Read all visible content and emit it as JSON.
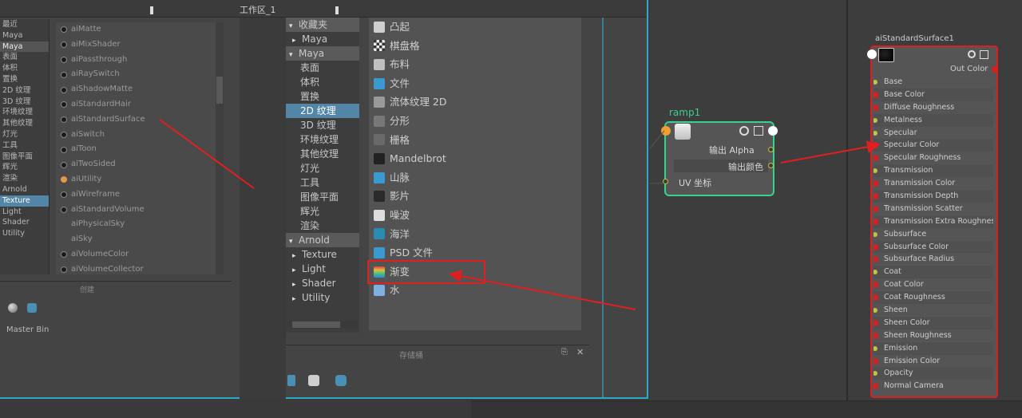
{
  "window": {
    "tab_title": "工作区_1"
  },
  "left_categories": {
    "items": [
      "最近",
      "Maya",
      "Maya",
      "表面",
      "体积",
      "置换",
      "2D 纹理",
      "3D 纹理",
      "环境纹理",
      "其他纹理",
      "灯光",
      "工具",
      "图像平面",
      "辉光",
      "渲染",
      "Arnold",
      "Texture",
      "Light",
      "Shader",
      "Utility"
    ],
    "selected": 16
  },
  "left_nodes": {
    "items": [
      {
        "label": "aiMatte",
        "dot": "dark"
      },
      {
        "label": "aiMixShader",
        "dot": "dark"
      },
      {
        "label": "aiPassthrough",
        "dot": "dark"
      },
      {
        "label": "aiRaySwitch",
        "dot": "dark"
      },
      {
        "label": "aiShadowMatte",
        "dot": "dark"
      },
      {
        "label": "aiStandardHair",
        "dot": "dark"
      },
      {
        "label": "aiStandardSurface",
        "dot": "dark"
      },
      {
        "label": "aiSwitch",
        "dot": "dark"
      },
      {
        "label": "aiToon",
        "dot": "dark"
      },
      {
        "label": "aiTwoSided",
        "dot": "dark"
      },
      {
        "label": "aiUtility",
        "dot": "orange"
      },
      {
        "label": "aiWireframe",
        "dot": "dark"
      },
      {
        "label": "aiStandardVolume",
        "dot": "dark"
      },
      {
        "label": "aiPhysicalSky",
        "dot": "blank"
      },
      {
        "label": "aiSky",
        "dot": "blank"
      },
      {
        "label": "aiVolumeColor",
        "dot": "dark"
      },
      {
        "label": "aiVolumeCollector",
        "dot": "dark"
      }
    ],
    "bottom_title": "创建",
    "master_bin": "Master Bin"
  },
  "mid_categories": {
    "items": [
      {
        "label": "收藏夹",
        "kind": "hdr",
        "tri": "▾"
      },
      {
        "label": "Maya",
        "kind": "sub",
        "tri": "▸"
      },
      {
        "label": "Maya",
        "kind": "hdr",
        "tri": "▾"
      },
      {
        "label": "表面",
        "kind": "item"
      },
      {
        "label": "体积",
        "kind": "item"
      },
      {
        "label": "置换",
        "kind": "item"
      },
      {
        "label": "2D 纹理",
        "kind": "sel"
      },
      {
        "label": "3D 纹理",
        "kind": "item"
      },
      {
        "label": "环境纹理",
        "kind": "item"
      },
      {
        "label": "其他纹理",
        "kind": "item"
      },
      {
        "label": "灯光",
        "kind": "item"
      },
      {
        "label": "工具",
        "kind": "item"
      },
      {
        "label": "图像平面",
        "kind": "item"
      },
      {
        "label": "辉光",
        "kind": "item"
      },
      {
        "label": "渲染",
        "kind": "item"
      },
      {
        "label": "Arnold",
        "kind": "hdr",
        "tri": "▾"
      },
      {
        "label": "Texture",
        "kind": "sub",
        "tri": "▸"
      },
      {
        "label": "Light",
        "kind": "sub",
        "tri": "▸"
      },
      {
        "label": "Shader",
        "kind": "sub",
        "tri": "▸"
      },
      {
        "label": "Utility",
        "kind": "sub",
        "tri": "▸"
      }
    ]
  },
  "mid_list": {
    "items": [
      {
        "label": "凸起",
        "icon": "bump-icon",
        "color": "#cfcfcf"
      },
      {
        "label": "棋盘格",
        "icon": "checker-icon",
        "color": "#888888"
      },
      {
        "label": "布料",
        "icon": "cloth-icon",
        "color": "#bfbfbf"
      },
      {
        "label": "文件",
        "icon": "file-icon",
        "color": "#3a9ad0"
      },
      {
        "label": "流体纹理 2D",
        "icon": "fluid-texture-icon",
        "color": "#9a9a9a"
      },
      {
        "label": "分形",
        "icon": "fractal-icon",
        "color": "#777777"
      },
      {
        "label": "栅格",
        "icon": "grid-icon",
        "color": "#6a6a6a"
      },
      {
        "label": "Mandelbrot",
        "icon": "mandelbrot-icon",
        "color": "#222222"
      },
      {
        "label": "山脉",
        "icon": "mountain-icon",
        "color": "#3a9ad0"
      },
      {
        "label": "影片",
        "icon": "movie-icon",
        "color": "#2a2a2a"
      },
      {
        "label": "噪波",
        "icon": "noise-icon",
        "color": "#dddddd"
      },
      {
        "label": "海洋",
        "icon": "ocean-icon",
        "color": "#2a8ab0"
      },
      {
        "label": "PSD 文件",
        "icon": "psd-file-icon",
        "color": "#3a9ad0"
      },
      {
        "label": "渐变",
        "icon": "ramp-icon",
        "color": "#4fb070"
      },
      {
        "label": "水",
        "icon": "water-icon",
        "color": "#7fb0e0"
      }
    ],
    "bottom_title": "存储桶",
    "close": "✕",
    "dock": "⎘"
  },
  "ramp_node": {
    "title": "ramp1",
    "out_alpha": "输出 Alpha",
    "out_color": "输出颜色",
    "uv_coord": "UV 坐标"
  },
  "ai_node": {
    "title": "aiStandardSurface1",
    "out_color": "Out Color",
    "attrs": [
      "Base",
      "Base Color",
      "Diffuse Roughness",
      "Metalness",
      "Specular",
      "Specular Color",
      "Specular Roughness",
      "Transmission",
      "Transmission Color",
      "Transmission Depth",
      "Transmission Scatter",
      "Transmission Extra Roughness",
      "Subsurface",
      "Subsurface Color",
      "Subsurface Radius",
      "Coat",
      "Coat Color",
      "Coat Roughness",
      "Sheen",
      "Sheen Color",
      "Sheen Roughness",
      "Emission",
      "Emission Color",
      "Opacity",
      "Normal Camera"
    ]
  },
  "colors": {
    "selection_blue": "#5285a6",
    "highlight_red": "#e02020",
    "ramp_green": "#3ccf8e",
    "panel_border_cyan": "#2ea9c5"
  }
}
